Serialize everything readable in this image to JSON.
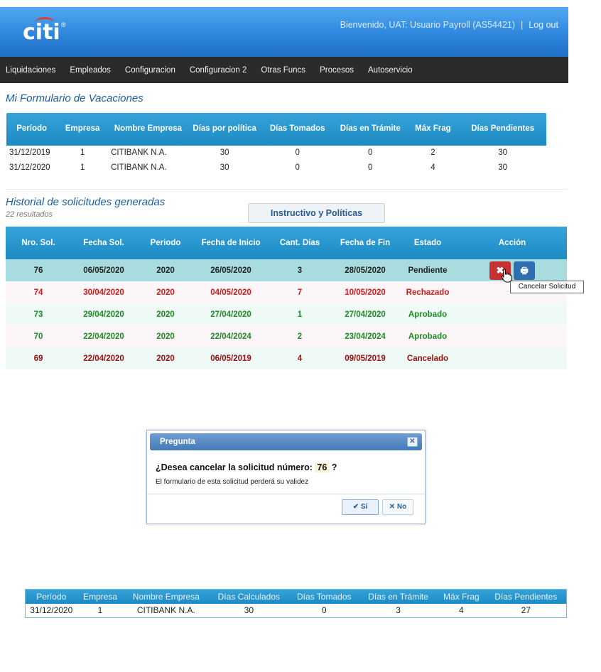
{
  "header": {
    "logo_text": "citi",
    "logo_reg": "®",
    "welcome": "Bienvenido,  UAT: Usuario Payroll (AS54421)",
    "separator": "|",
    "logout": "Log out",
    "colors": {
      "header_top": "#4fa8f0",
      "header_bottom": "#1f6fc6",
      "nav_bg": "#2b2b2b"
    }
  },
  "nav": [
    "Liquidaciones",
    "Empleados",
    "Configuracion",
    "Configuracion 2",
    "Otras Funcs",
    "Procesos",
    "Autoservicio"
  ],
  "form": {
    "title": "Mi Formulario de Vacaciones",
    "headers": [
      "Período",
      "Empresa",
      "Nombre Empresa",
      "Días por política",
      "Días Tomados",
      "Días en Trámite",
      "Máx Frag",
      "Días Pendientes"
    ],
    "rows": [
      [
        "31/12/2019",
        "1",
        "CITIBANK N.A.",
        "30",
        "0",
        "0",
        "2",
        "30"
      ],
      [
        "31/12/2020",
        "1",
        "CITIBANK N.A.",
        "30",
        "0",
        "0",
        "4",
        "30"
      ]
    ]
  },
  "history": {
    "title": "Historial de solicitudes generadas",
    "results": "22 resultados",
    "instr_button": "Instructivo y Políticas",
    "headers": [
      "Nro. Sol.",
      "Fecha Sol.",
      "Periodo",
      "Fecha de Inicio",
      "Cant. Días",
      "Fecha de Fin",
      "Estado",
      "Acción"
    ],
    "rows": [
      [
        "76",
        "06/05/2020",
        "2020",
        "26/05/2020",
        "3",
        "28/05/2020",
        "Pendiente"
      ],
      [
        "74",
        "30/04/2020",
        "2020",
        "04/05/2020",
        "7",
        "10/05/2020",
        "Rechazado"
      ],
      [
        "73",
        "29/04/2020",
        "2020",
        "27/04/2020",
        "1",
        "27/04/2020",
        "Aprobado"
      ],
      [
        "70",
        "22/04/2020",
        "2020",
        "22/04/2024",
        "2",
        "23/04/2024",
        "Aprobado"
      ],
      [
        "69",
        "22/04/2020",
        "2020",
        "06/05/2019",
        "4",
        "09/05/2019",
        "Cancelado"
      ]
    ],
    "cancel_icon": "x-icon",
    "print_icon": "printer-icon",
    "tooltip": "Cancelar Solicitud"
  },
  "dialog": {
    "title": "Pregunta",
    "question_prefix": "¿Desea cancelar la solicitud número:",
    "number": "76",
    "question_suffix": "?",
    "subtitle": "El formulario de esta solicitud perderá su validez",
    "yes": "Sí",
    "no": "No"
  },
  "summary": {
    "headers": [
      "Período",
      "Empresa",
      "Nombre Empresa",
      "Días Calculados",
      "Días Tomados",
      "Días en Trámite",
      "Máx Frag",
      "Días Pendientes"
    ],
    "row": [
      "31/12/2020",
      "1",
      "CITIBANK N.A.",
      "30",
      "0",
      "3",
      "4",
      "27"
    ]
  }
}
